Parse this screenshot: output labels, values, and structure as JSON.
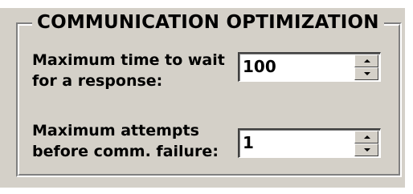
{
  "group": {
    "title": "COMMUNICATION OPTIMIZATION"
  },
  "fields": [
    {
      "label_line1": "Maximum time to wait",
      "label_line2": "for a response:",
      "value": "100"
    },
    {
      "label_line1": "Maximum attempts",
      "label_line2": "before comm. failure:",
      "value": "1"
    }
  ],
  "icons": {
    "spin_up": "arrow-up-icon",
    "spin_down": "arrow-down-icon"
  },
  "colors": {
    "background": "#d4d0c8",
    "field_background": "#ffffff",
    "text": "#000000"
  }
}
